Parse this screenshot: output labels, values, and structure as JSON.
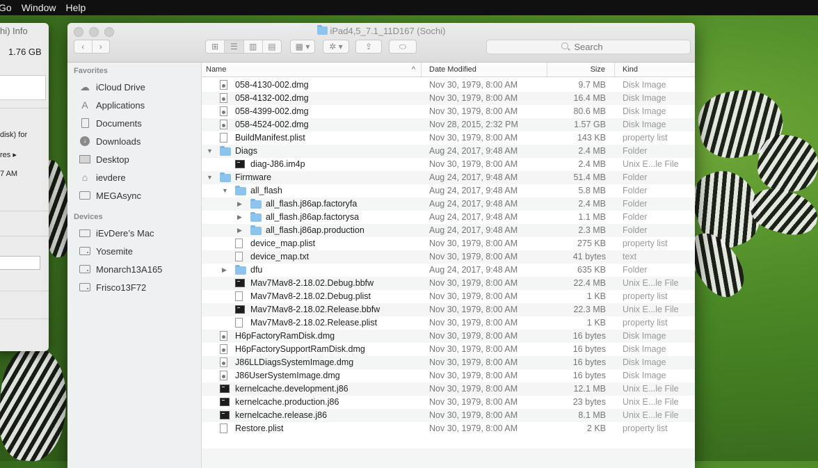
{
  "menubar": {
    "items": [
      "Go",
      "Window",
      "Help"
    ]
  },
  "info_window": {
    "title": "hi) Info",
    "size": "1.76 GB",
    "line1": "disk) for",
    "line2": "res ▸",
    "line3": "7 AM"
  },
  "window": {
    "title": "iPad4,5_7.1_11D167 (Sochi)"
  },
  "toolbar": {
    "back_icon": "chevron-left-icon",
    "forward_icon": "chevron-right-icon",
    "views": [
      "⊞",
      "☰",
      "▥",
      "▤"
    ],
    "arrange_label": "▦ ▾",
    "action_label": "✲ ▾",
    "share_label": "⇪",
    "tag_label": "⬭"
  },
  "search": {
    "placeholder": "Search"
  },
  "sidebar": {
    "favorites_label": "Favorites",
    "favorites": [
      {
        "label": "iCloud Drive",
        "icon": "cloud-icon"
      },
      {
        "label": "Applications",
        "icon": "applications-icon"
      },
      {
        "label": "Documents",
        "icon": "documents-icon"
      },
      {
        "label": "Downloads",
        "icon": "downloads-icon"
      },
      {
        "label": "Desktop",
        "icon": "desktop-icon"
      },
      {
        "label": "ievdere",
        "icon": "home-icon"
      },
      {
        "label": "MEGAsync",
        "icon": "folder-icon"
      }
    ],
    "devices_label": "Devices",
    "devices": [
      {
        "label": "iEvDere’s Mac",
        "icon": "computer-icon"
      },
      {
        "label": "Yosemite",
        "icon": "drive-icon"
      },
      {
        "label": "Monarch13A165",
        "icon": "drive-icon"
      },
      {
        "label": "Frisco13F72",
        "icon": "drive-icon"
      }
    ]
  },
  "columns": {
    "name": "Name",
    "date": "Date Modified",
    "size": "Size",
    "kind": "Kind"
  },
  "files": [
    {
      "name": "058-4130-002.dmg",
      "date": "Nov 30, 1979, 8:00 AM",
      "size": "9.7 MB",
      "kind": "Disk Image",
      "depth": 0,
      "icon": "dmg",
      "tri": ""
    },
    {
      "name": "058-4132-002.dmg",
      "date": "Nov 30, 1979, 8:00 AM",
      "size": "16.4 MB",
      "kind": "Disk Image",
      "depth": 0,
      "icon": "dmg",
      "tri": ""
    },
    {
      "name": "058-4399-002.dmg",
      "date": "Nov 30, 1979, 8:00 AM",
      "size": "80.6 MB",
      "kind": "Disk Image",
      "depth": 0,
      "icon": "dmg",
      "tri": ""
    },
    {
      "name": "058-4524-002.dmg",
      "date": "Nov 28, 2015, 2:32 PM",
      "size": "1.57 GB",
      "kind": "Disk Image",
      "depth": 0,
      "icon": "dmg",
      "tri": ""
    },
    {
      "name": "BuildManifest.plist",
      "date": "Nov 30, 1979, 8:00 AM",
      "size": "143 KB",
      "kind": "property list",
      "depth": 0,
      "icon": "doc",
      "tri": ""
    },
    {
      "name": "Diags",
      "date": "Aug 24, 2017, 9:48 AM",
      "size": "2.4 MB",
      "kind": "Folder",
      "depth": 0,
      "icon": "folder",
      "tri": "▼"
    },
    {
      "name": "diag-J86.im4p",
      "date": "Nov 30, 1979, 8:00 AM",
      "size": "2.4 MB",
      "kind": "Unix E...le File",
      "depth": 1,
      "icon": "exe",
      "tri": ""
    },
    {
      "name": "Firmware",
      "date": "Aug 24, 2017, 9:48 AM",
      "size": "51.4 MB",
      "kind": "Folder",
      "depth": 0,
      "icon": "folder",
      "tri": "▼"
    },
    {
      "name": "all_flash",
      "date": "Aug 24, 2017, 9:48 AM",
      "size": "5.8 MB",
      "kind": "Folder",
      "depth": 1,
      "icon": "folder",
      "tri": "▼"
    },
    {
      "name": "all_flash.j86ap.factoryfa",
      "date": "Aug 24, 2017, 9:48 AM",
      "size": "2.4 MB",
      "kind": "Folder",
      "depth": 2,
      "icon": "folder",
      "tri": "▶"
    },
    {
      "name": "all_flash.j86ap.factorysa",
      "date": "Aug 24, 2017, 9:48 AM",
      "size": "1.1 MB",
      "kind": "Folder",
      "depth": 2,
      "icon": "folder",
      "tri": "▶"
    },
    {
      "name": "all_flash.j86ap.production",
      "date": "Aug 24, 2017, 9:48 AM",
      "size": "2.3 MB",
      "kind": "Folder",
      "depth": 2,
      "icon": "folder",
      "tri": "▶"
    },
    {
      "name": "device_map.plist",
      "date": "Nov 30, 1979, 8:00 AM",
      "size": "275 KB",
      "kind": "property list",
      "depth": 1,
      "icon": "doc",
      "tri": ""
    },
    {
      "name": "device_map.txt",
      "date": "Nov 30, 1979, 8:00 AM",
      "size": "41 bytes",
      "kind": "text",
      "depth": 1,
      "icon": "doc",
      "tri": ""
    },
    {
      "name": "dfu",
      "date": "Aug 24, 2017, 9:48 AM",
      "size": "635 KB",
      "kind": "Folder",
      "depth": 1,
      "icon": "folder",
      "tri": "▶"
    },
    {
      "name": "Mav7Mav8-2.18.02.Debug.bbfw",
      "date": "Nov 30, 1979, 8:00 AM",
      "size": "22.4 MB",
      "kind": "Unix E...le File",
      "depth": 1,
      "icon": "exe",
      "tri": ""
    },
    {
      "name": "Mav7Mav8-2.18.02.Debug.plist",
      "date": "Nov 30, 1979, 8:00 AM",
      "size": "1 KB",
      "kind": "property list",
      "depth": 1,
      "icon": "doc",
      "tri": ""
    },
    {
      "name": "Mav7Mav8-2.18.02.Release.bbfw",
      "date": "Nov 30, 1979, 8:00 AM",
      "size": "22.3 MB",
      "kind": "Unix E...le File",
      "depth": 1,
      "icon": "exe",
      "tri": ""
    },
    {
      "name": "Mav7Mav8-2.18.02.Release.plist",
      "date": "Nov 30, 1979, 8:00 AM",
      "size": "1 KB",
      "kind": "property list",
      "depth": 1,
      "icon": "doc",
      "tri": ""
    },
    {
      "name": "H6pFactoryRamDisk.dmg",
      "date": "Nov 30, 1979, 8:00 AM",
      "size": "16 bytes",
      "kind": "Disk Image",
      "depth": 0,
      "icon": "dmg",
      "tri": ""
    },
    {
      "name": "H6pFactorySupportRamDisk.dmg",
      "date": "Nov 30, 1979, 8:00 AM",
      "size": "16 bytes",
      "kind": "Disk Image",
      "depth": 0,
      "icon": "dmg",
      "tri": ""
    },
    {
      "name": "J86LLDiagsSystemImage.dmg",
      "date": "Nov 30, 1979, 8:00 AM",
      "size": "16 bytes",
      "kind": "Disk Image",
      "depth": 0,
      "icon": "dmg",
      "tri": ""
    },
    {
      "name": "J86UserSystemImage.dmg",
      "date": "Nov 30, 1979, 8:00 AM",
      "size": "16 bytes",
      "kind": "Disk Image",
      "depth": 0,
      "icon": "dmg",
      "tri": ""
    },
    {
      "name": "kernelcache.development.j86",
      "date": "Nov 30, 1979, 8:00 AM",
      "size": "12.1 MB",
      "kind": "Unix E...le File",
      "depth": 0,
      "icon": "exe",
      "tri": ""
    },
    {
      "name": "kernelcache.production.j86",
      "date": "Nov 30, 1979, 8:00 AM",
      "size": "23 bytes",
      "kind": "Unix E...le File",
      "depth": 0,
      "icon": "exe",
      "tri": ""
    },
    {
      "name": "kernelcache.release.j86",
      "date": "Nov 30, 1979, 8:00 AM",
      "size": "8.1 MB",
      "kind": "Unix E...le File",
      "depth": 0,
      "icon": "exe",
      "tri": ""
    },
    {
      "name": "Restore.plist",
      "date": "Nov 30, 1979, 8:00 AM",
      "size": "2 KB",
      "kind": "property list",
      "depth": 0,
      "icon": "doc",
      "tri": ""
    }
  ]
}
